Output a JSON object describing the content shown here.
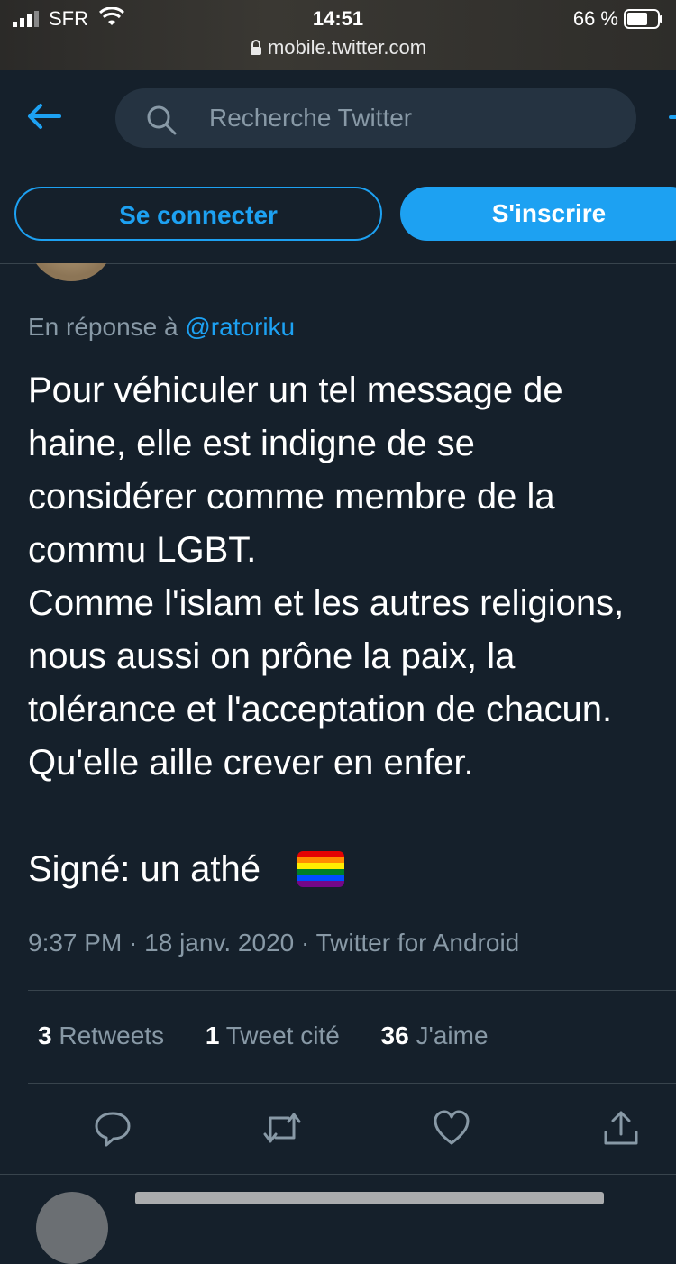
{
  "status_bar": {
    "carrier": "SFR",
    "time": "14:51",
    "battery": "66 %",
    "url": "mobile.twitter.com"
  },
  "search": {
    "placeholder": "Recherche Twitter"
  },
  "auth": {
    "login": "Se connecter",
    "signup": "S'inscrire"
  },
  "tweet": {
    "reply_prefix": "En réponse à ",
    "reply_handle": "@ratoriku",
    "text": "Pour véhiculer un tel message de\nhaine, elle est indigne de se\nconsidérer comme membre de la\ncommu LGBT.\nComme l'islam et les autres religions,\nnous aussi on prône la paix, la\ntolérance et l'acceptation de chacun.\nQu'elle aille crever en enfer.\n\nSigné: un athé",
    "meta": "9:37 PM · 18 janv. 2020 · Twitter for Android"
  },
  "stats": {
    "retweets_count": "3",
    "retweets_label": " Retweets",
    "quotes_count": "1",
    "quotes_label": " Tweet cité",
    "likes_count": "36",
    "likes_label": " J'aime"
  },
  "colors": {
    "accent": "#1da1f2",
    "background": "#15202b",
    "muted": "#8899a6"
  },
  "icons": [
    "back-arrow-icon",
    "search-icon",
    "reply-icon",
    "retweet-icon",
    "like-icon",
    "share-icon",
    "rainbow-flag-icon"
  ]
}
